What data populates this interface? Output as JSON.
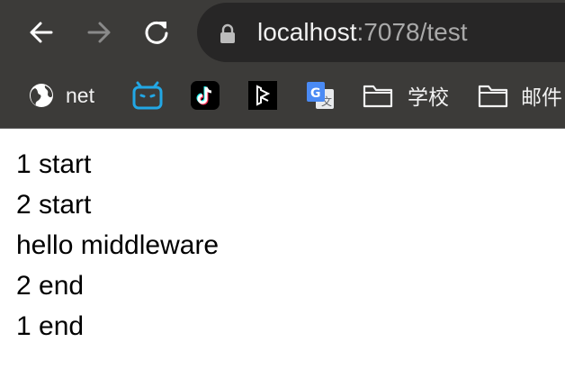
{
  "browser": {
    "url_host": "localhost",
    "url_path": ":7078/test",
    "bookmarks": [
      {
        "label": "net",
        "icon": "globe-icon"
      },
      {
        "label": "",
        "icon": "bilibili-icon"
      },
      {
        "label": "",
        "icon": "tiktok-icon"
      },
      {
        "label": "",
        "icon": "app-bookmark-icon"
      },
      {
        "label": "",
        "icon": "google-translate-icon"
      },
      {
        "label": "学校",
        "icon": "folder-icon"
      },
      {
        "label": "邮件",
        "icon": "folder-icon"
      }
    ]
  },
  "page": {
    "lines": [
      "1 start",
      "2 start",
      "hello middleware",
      "2 end",
      "1 end"
    ]
  }
}
